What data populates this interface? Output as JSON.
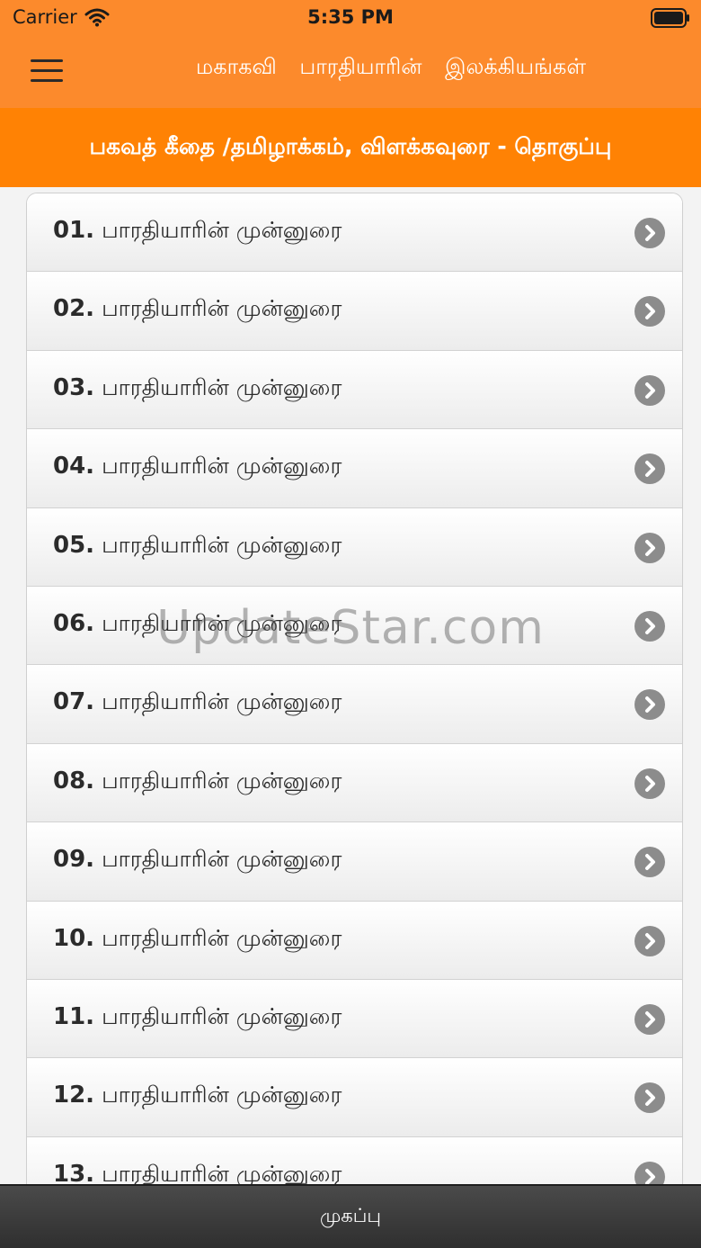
{
  "status_bar": {
    "carrier": "Carrier",
    "time": "5:35 PM"
  },
  "nav": {
    "title": "மகாகவி பாரதியாரின் இலக்கியங்கள்"
  },
  "section": {
    "title": "பகவத் கீதை /தமிழாக்கம், விளக்கவுரை - தொகுப்பு"
  },
  "list": {
    "items": [
      {
        "num": "01.",
        "label": "பாரதியாரின் முன்னுரை"
      },
      {
        "num": "02.",
        "label": "பாரதியாரின் முன்னுரை"
      },
      {
        "num": "03.",
        "label": "பாரதியாரின் முன்னுரை"
      },
      {
        "num": "04.",
        "label": "பாரதியாரின் முன்னுரை"
      },
      {
        "num": "05.",
        "label": "பாரதியாரின் முன்னுரை"
      },
      {
        "num": "06.",
        "label": "பாரதியாரின் முன்னுரை"
      },
      {
        "num": "07.",
        "label": "பாரதியாரின் முன்னுரை"
      },
      {
        "num": "08.",
        "label": "பாரதியாரின் முன்னுரை"
      },
      {
        "num": "09.",
        "label": "பாரதியாரின் முன்னுரை"
      },
      {
        "num": "10.",
        "label": "பாரதியாரின் முன்னுரை"
      },
      {
        "num": "11.",
        "label": "பாரதியாரின் முன்னுரை"
      },
      {
        "num": "12.",
        "label": "பாரதியாரின் முன்னுரை"
      },
      {
        "num": "13.",
        "label": "பாரதியாரின் முன்னுரை"
      }
    ]
  },
  "watermark": "UpdateStar.com",
  "footer": {
    "label": "முகப்பு"
  },
  "icons": {
    "menu": "hamburger-menu-icon",
    "row": "chevron-right-circle-icon",
    "wifi": "wifi-icon",
    "battery": "battery-icon"
  },
  "colors": {
    "nav_orange": "#fc8a2c",
    "header_orange": "#ff8204",
    "footer_dark": "#3a3a3a",
    "chevron_gray": "#8c8c8c"
  }
}
